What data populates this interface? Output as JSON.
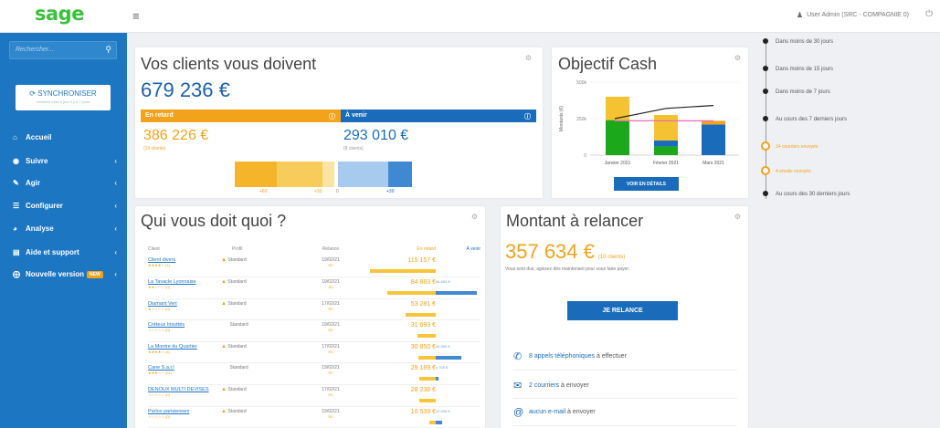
{
  "brand": {
    "logo": "sage"
  },
  "topbar": {
    "user": "User Admin (SRC - COMPAGNIE 0)"
  },
  "sidebar": {
    "search_placeholder": "Rechercher...",
    "sync_label": "SYNCHRONISER",
    "sync_sub": "Dernière mise à jour il y a 7 jours",
    "items": [
      {
        "label": "Accueil",
        "icon": "home-icon"
      },
      {
        "label": "Suivre",
        "icon": "eye-icon"
      },
      {
        "label": "Agir",
        "icon": "edit-icon"
      },
      {
        "label": "Configurer",
        "icon": "sliders-icon"
      },
      {
        "label": "Analyse",
        "icon": "pie-icon"
      },
      {
        "label": "Aide et support",
        "icon": "book-icon"
      },
      {
        "label": "Nouvelle version",
        "icon": "plus-icon",
        "badge": "NEW"
      }
    ]
  },
  "owe": {
    "title": "Vos clients vous doivent",
    "total": "679 236 €",
    "late_label": "En retard",
    "due_label": "À venir",
    "late_value": "386 226 €",
    "late_sub": "(10 clients)",
    "due_value": "293 010 €",
    "due_sub": "(8 clients)",
    "axis": [
      "+60",
      "+30",
      "0",
      "+30"
    ]
  },
  "cash": {
    "title": "Objectif Cash",
    "button": "VOIR EN DÉTAILS"
  },
  "chart_data": {
    "type": "bar",
    "stacked": true,
    "ylabel": "Montants (€)",
    "yticks": [
      "500k",
      "250k",
      "0"
    ],
    "ylim": [
      0,
      500000
    ],
    "categories": [
      "Janvier 2021",
      "Février 2021",
      "Mars 2021"
    ],
    "series": [
      {
        "color": "#1ba81b",
        "values": [
          240000,
          60000,
          0
        ]
      },
      {
        "color": "#1a6cba",
        "values": [
          0,
          40000,
          210000
        ]
      },
      {
        "color": "#f5c232",
        "values": [
          160000,
          175000,
          0
        ]
      },
      {
        "color": "#f2a31b",
        "values": [
          0,
          0,
          25000
        ]
      }
    ],
    "lines": [
      {
        "color": "#222",
        "values": [
          250000,
          320000,
          340000
        ]
      },
      {
        "color": "#e86fb6",
        "values": [
          235000,
          235000,
          235000
        ]
      }
    ]
  },
  "who": {
    "title": "Qui vous doit quoi ?",
    "columns": [
      "Client",
      "Profil",
      "Relance",
      "En retard",
      "À venir"
    ],
    "rows": [
      {
        "name": "Client divers",
        "stars": "★★★★☆ (4)",
        "profile": "Standard",
        "warn": true,
        "relance": "19/02/21",
        "rel2": "R0",
        "late": "115 157 €",
        "due": ""
      },
      {
        "name": "La Tavacle Lyonnaise",
        "stars": "★★☆☆☆ (0)",
        "profile": "Standard",
        "warn": true,
        "relance": "19/02/21",
        "rel2": "R0",
        "late": "84 883 €",
        "due": "84 883 €"
      },
      {
        "name": "Diamant Vert",
        "stars": "★☆☆☆☆ (0)",
        "profile": "Standard",
        "warn": true,
        "relance": "17/02/21",
        "rel2": "R0",
        "late": "53 281 €",
        "due": ""
      },
      {
        "name": "Créteux Irisuttés",
        "stars": "☆☆☆☆☆ (0)",
        "profile": "Standard",
        "warn": false,
        "relance": "19/02/21",
        "rel2": "R0",
        "late": "31 693 €",
        "due": ""
      },
      {
        "name": "La Montre du Quartier",
        "stars": "★★★★☆ (4)",
        "profile": "Standard",
        "warn": true,
        "relance": "17/02/21",
        "rel2": "R0",
        "late": "30 850 €",
        "due": "44 850 €"
      },
      {
        "name": "Cane S.a.r.l",
        "stars": "★★★☆☆ (21)",
        "profile": "Standard",
        "warn": false,
        "relance": "19/02/21",
        "rel2": "R0",
        "late": "29 189 €",
        "due": "4 705 €"
      },
      {
        "name": "DENOUX MULTI DEVISES",
        "stars": "☆☆☆☆☆ (0)",
        "profile": "Standard",
        "warn": true,
        "relance": "17/02/21",
        "rel2": "R0",
        "late": "28 238 €",
        "due": ""
      },
      {
        "name": "Parlos parisiennes",
        "stars": "☆☆☆☆☆ (0)",
        "profile": "Standard",
        "warn": true,
        "relance": "19/02/21",
        "rel2": "R0",
        "late": "10 539 €",
        "due": "10 539 €"
      }
    ]
  },
  "relance": {
    "title": "Montant à relancer",
    "amount": "357 634 €",
    "amount_sub": "(10 clients)",
    "subtitle": "Vous sont dus, agissez dès maintenant pour vous faire payer.",
    "button": "JE RELANCE",
    "actions": [
      {
        "icon": "phone-icon",
        "highlight": "8 appels téléphoniques",
        "rest": " à effectuer"
      },
      {
        "icon": "envelope-icon",
        "highlight": "2 courriers",
        "rest": " à envoyer"
      },
      {
        "icon": "at-icon",
        "highlight": "aucun e-mail",
        "rest": " à envoyer"
      }
    ]
  },
  "timeline": [
    {
      "label": "Dans moins de 30 jours",
      "type": "dot"
    },
    {
      "label": "Dans moins de 15 jours",
      "type": "dot"
    },
    {
      "label": "Dans moins de 7 jours",
      "type": "dot"
    },
    {
      "label": "Au cours des 7 derniers jours",
      "type": "dot"
    },
    {
      "label": "14 courriers envoyés",
      "type": "ring"
    },
    {
      "label": "4 emails envoyés",
      "type": "ring"
    },
    {
      "label": "Au cours des 30 derniers jours",
      "type": "dot"
    }
  ]
}
